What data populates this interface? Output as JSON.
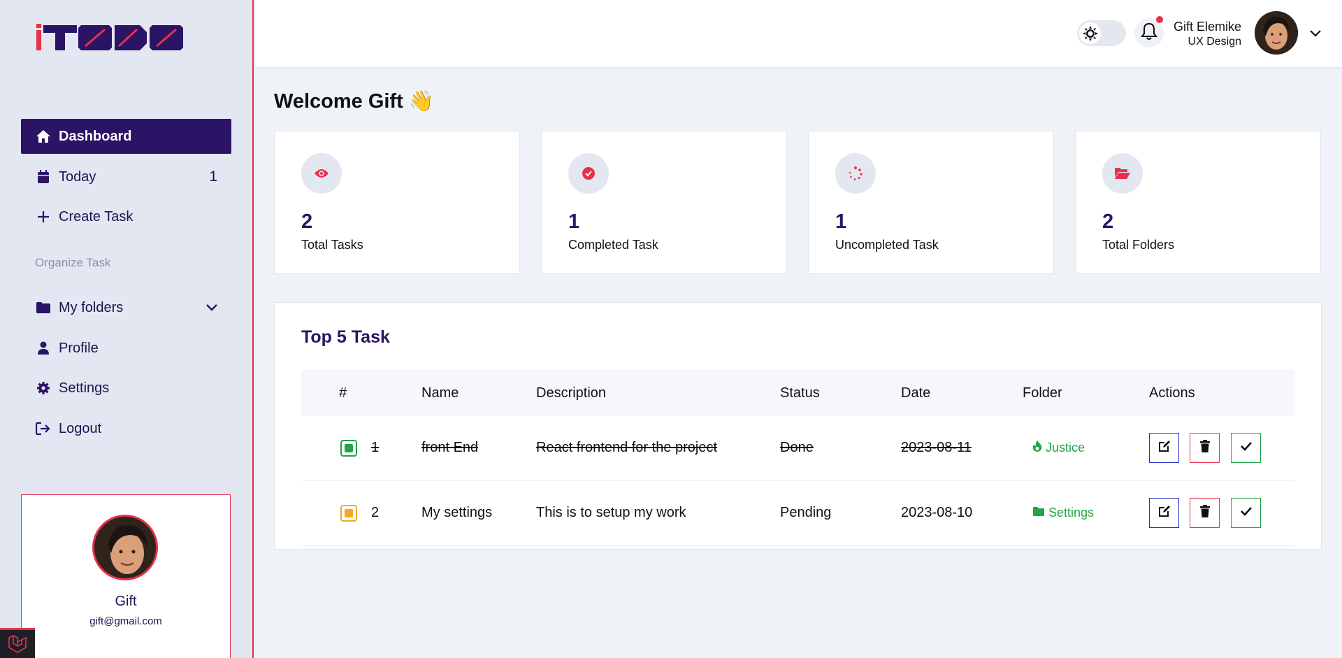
{
  "brand": {
    "logo_text": "iTODO"
  },
  "sidebar": {
    "items": [
      {
        "label": "Dashboard",
        "icon": "home-icon",
        "active": true
      },
      {
        "label": "Today",
        "icon": "calendar-icon",
        "count": "1"
      },
      {
        "label": "Create Task",
        "icon": "plus-icon"
      },
      {
        "label": "My folders",
        "icon": "folder-icon"
      },
      {
        "label": "Profile",
        "icon": "user-icon"
      },
      {
        "label": "Settings",
        "icon": "gear-icon"
      },
      {
        "label": "Logout",
        "icon": "logout-icon"
      }
    ],
    "section_label": "Organize Task",
    "profile": {
      "name": "Gift",
      "email": "gift@gmail.com"
    }
  },
  "header": {
    "user_name": "Gift Elemike",
    "user_role": "UX Design"
  },
  "main": {
    "welcome": "Welcome Gift",
    "welcome_emoji": "👋",
    "stats": [
      {
        "value": "2",
        "label": "Total Tasks",
        "icon": "eye-icon"
      },
      {
        "value": "1",
        "label": "Completed Task",
        "icon": "check-circle-icon"
      },
      {
        "value": "1",
        "label": "Uncompleted Task",
        "icon": "spinner-icon"
      },
      {
        "value": "2",
        "label": "Total Folders",
        "icon": "folder-open-icon"
      }
    ],
    "table": {
      "title": "Top 5 Task",
      "headers": [
        "#",
        "Name",
        "Description",
        "Status",
        "Date",
        "Folder",
        "Actions"
      ],
      "rows": [
        {
          "num": "1",
          "name": "front End",
          "description": "React frontend for the project",
          "status": "Done",
          "date": "2023-08-11",
          "folder": "Justice",
          "folder_icon": "fire-icon",
          "completed": true
        },
        {
          "num": "2",
          "name": "My settings",
          "description": "This is to setup my work",
          "status": "Pending",
          "date": "2023-08-10",
          "folder": "Settings",
          "folder_icon": "folder-icon",
          "completed": false
        }
      ]
    }
  },
  "colors": {
    "brand": "#2b1365",
    "accent": "#e8304b",
    "success": "#22a447",
    "edit": "#2333c6",
    "pending": "#f5a623"
  }
}
